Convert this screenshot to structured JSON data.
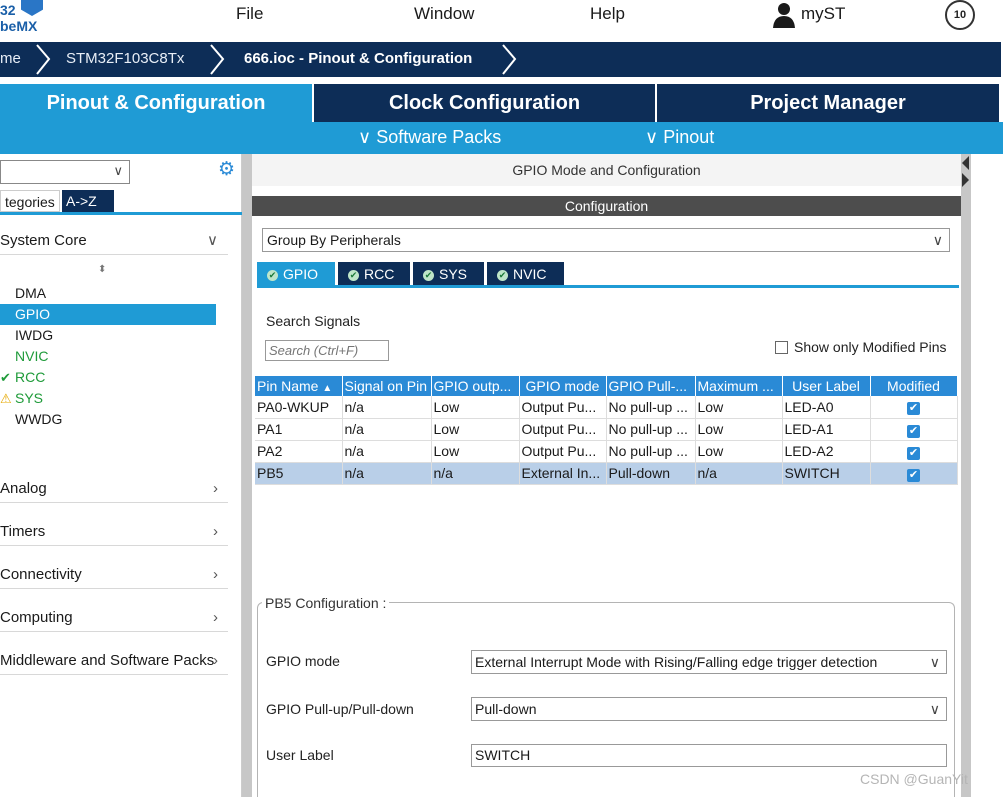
{
  "menubar": {
    "logo_line1": "32",
    "logo_line2": "beMX",
    "items": [
      "File",
      "Window",
      "Help"
    ],
    "user_label": "myST",
    "badge": "10"
  },
  "breadcrumb": [
    "me",
    "STM32F103C8Tx",
    "666.ioc - Pinout & Configuration"
  ],
  "tabs": [
    "Pinout & Configuration",
    "Clock Configuration",
    "Project Manager"
  ],
  "subtabs": [
    "Software Packs",
    "Pinout"
  ],
  "sidebar": {
    "tabs": [
      "tegories",
      "A->Z"
    ],
    "categories": [
      "System Core",
      "Analog",
      "Timers",
      "Connectivity",
      "Computing",
      "Middleware and Software Packs"
    ],
    "system_core_items": [
      {
        "label": "DMA",
        "status": ""
      },
      {
        "label": "GPIO",
        "status": "selected"
      },
      {
        "label": "IWDG",
        "status": ""
      },
      {
        "label": "NVIC",
        "status": "green"
      },
      {
        "label": "RCC",
        "status": "check"
      },
      {
        "label": "SYS",
        "status": "warning"
      },
      {
        "label": "WWDG",
        "status": ""
      }
    ]
  },
  "content": {
    "title": "GPIO Mode and Configuration",
    "config_title": "Configuration",
    "group_by": "Group By Peripherals",
    "peripheral_tabs": [
      "GPIO",
      "RCC",
      "SYS",
      "NVIC"
    ],
    "search_label": "Search Signals",
    "search_placeholder": "Search (Ctrl+F)",
    "show_modified_label": "Show only Modified Pins"
  },
  "table": {
    "headers": [
      "Pin Name",
      "Signal on Pin",
      "GPIO outp...",
      "GPIO mode",
      "GPIO Pull-...",
      "Maximum ...",
      "User Label",
      "Modified"
    ],
    "rows": [
      [
        "PA0-WKUP",
        "n/a",
        "Low",
        "Output Pu...",
        "No pull-up ...",
        "Low",
        "LED-A0",
        true
      ],
      [
        "PA1",
        "n/a",
        "Low",
        "Output Pu...",
        "No pull-up ...",
        "Low",
        "LED-A1",
        true
      ],
      [
        "PA2",
        "n/a",
        "Low",
        "Output Pu...",
        "No pull-up ...",
        "Low",
        "LED-A2",
        true
      ],
      [
        "PB5",
        "n/a",
        "n/a",
        "External In...",
        "Pull-down",
        "n/a",
        "SWITCH",
        true
      ]
    ],
    "selected_row": 3
  },
  "pb5_config": {
    "legend": "PB5 Configuration :",
    "mode_label": "GPIO mode",
    "mode_value": "External Interrupt Mode with Rising/Falling edge trigger detection",
    "pull_label": "GPIO Pull-up/Pull-down",
    "pull_value": "Pull-down",
    "user_label_label": "User Label",
    "user_label_value": "SWITCH"
  },
  "watermark": "CSDN @GuanYit",
  "colors": {
    "navy": "#0d2d57",
    "blue": "#1f9bd5",
    "tab_dark": "#0d2d57",
    "table_header": "#2a8ad6",
    "selected_row": "#b9cfe8"
  }
}
